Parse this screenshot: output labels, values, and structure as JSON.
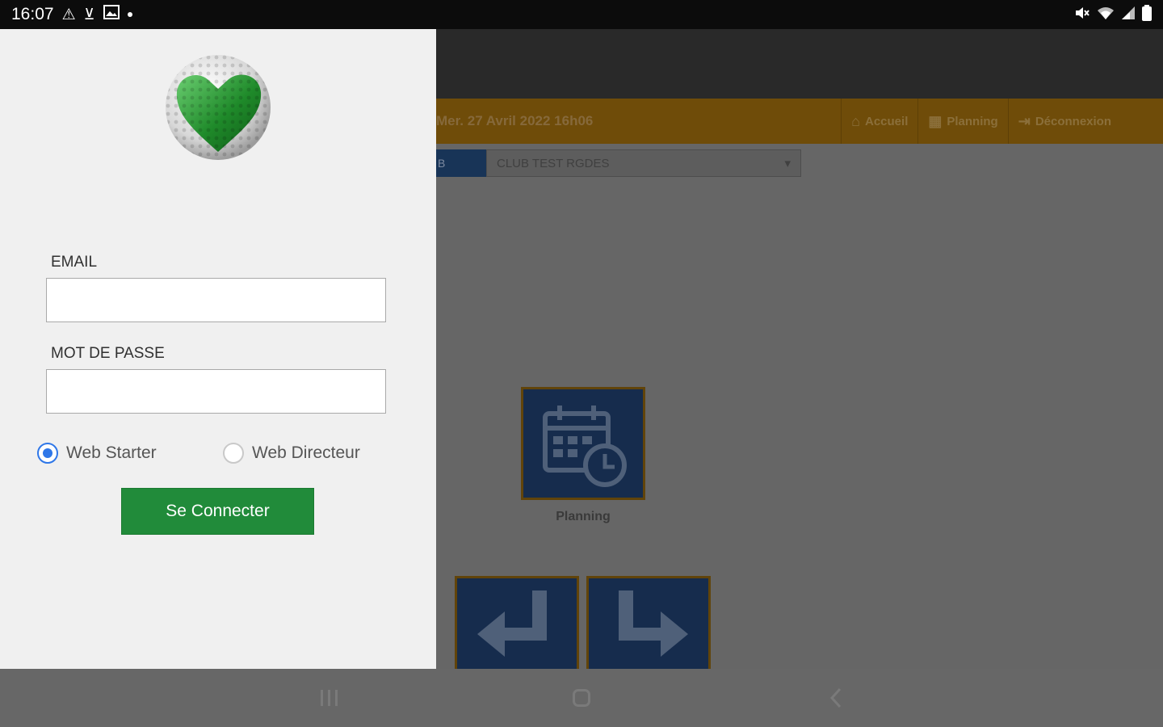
{
  "status_bar": {
    "time": "16:07",
    "left_icons": [
      "warning-icon",
      "download-done-icon",
      "image-icon",
      "dot-icon"
    ],
    "right_icons": [
      "mute-icon",
      "wifi-icon",
      "signal-icon",
      "battery-icon"
    ]
  },
  "background_app": {
    "date": "Mer. 27 Avril 2022 16h06",
    "nav": {
      "home": "Accueil",
      "planning": "Planning",
      "logout": "Déconnexion"
    },
    "club_tab": "B",
    "club_select": "CLUB TEST RGDES",
    "tile_planning_label": "Planning",
    "colors": {
      "nav_bar": "#6f4c09",
      "tile": "#162c4d"
    }
  },
  "login": {
    "email_label": "EMAIL",
    "email_value": "",
    "password_label": "MOT DE PASSE",
    "password_value": "",
    "radio_options": [
      {
        "label": "Web Starter",
        "checked": true
      },
      {
        "label": "Web Directeur",
        "checked": false
      }
    ],
    "submit_label": "Se Connecter",
    "colors": {
      "button": "#218b3a",
      "radio_accent": "#2f77e8",
      "panel": "#f0f0f0"
    }
  },
  "nav_bar": {
    "buttons": [
      "recent-apps-icon",
      "home-icon",
      "back-icon"
    ]
  }
}
